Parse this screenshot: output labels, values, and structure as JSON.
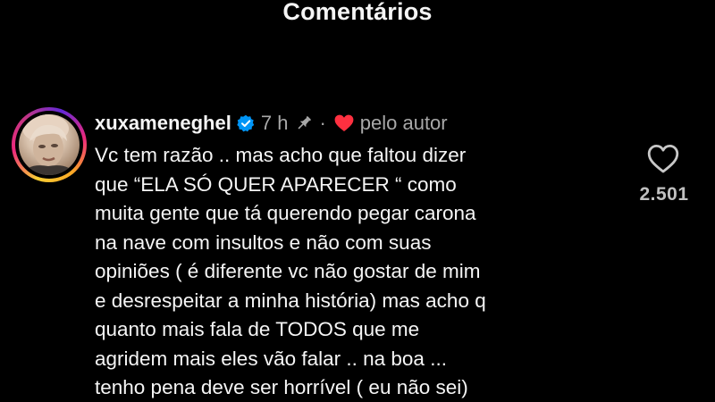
{
  "header": {
    "title": "Comentários"
  },
  "comment": {
    "username": "xuxameneghel",
    "time": "7 h",
    "separator": "·",
    "liked_by_author": "pelo autor",
    "lines": [
      "Vc tem razão .. mas acho que faltou dizer",
      "que “ELA SÓ QUER APARECER “ como",
      "muita gente que tá querendo pegar carona",
      "na nave com insultos e não com suas",
      "opiniões ( é diferente vc não gostar de mim",
      "e desrespeitar a minha história) mas acho q",
      "quanto mais fala de TODOS que me",
      "agridem mais eles vão falar .. na boa ...",
      "tenho pena deve ser horrível ( eu não sei)"
    ],
    "like_count": "2.501"
  },
  "icons": {
    "verified": "verified-badge-icon",
    "pin": "pin-icon",
    "author_heart": "heart-filled-icon",
    "like": "heart-outline-icon"
  },
  "colors": {
    "background": "#000000",
    "text": "#f5f5f5",
    "muted": "#a8a8a8",
    "verified_blue": "#0095f6",
    "heart_red": "#ff3040"
  }
}
